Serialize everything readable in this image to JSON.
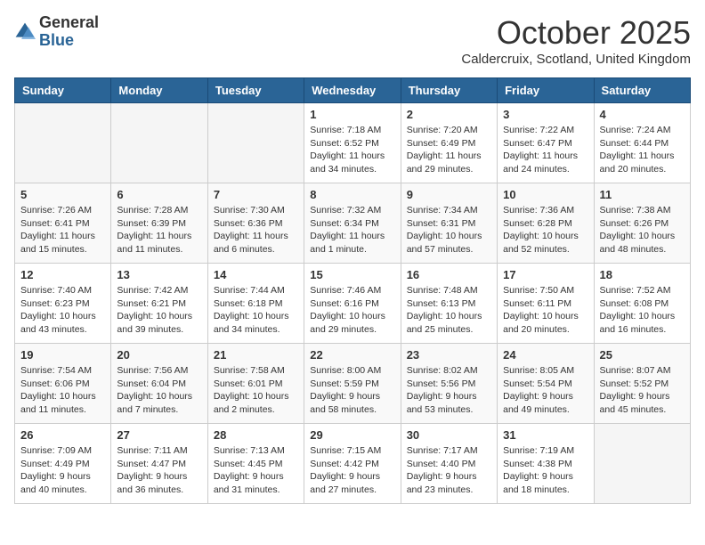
{
  "logo": {
    "general": "General",
    "blue": "Blue"
  },
  "title": "October 2025",
  "location": "Caldercruix, Scotland, United Kingdom",
  "days_of_week": [
    "Sunday",
    "Monday",
    "Tuesday",
    "Wednesday",
    "Thursday",
    "Friday",
    "Saturday"
  ],
  "weeks": [
    [
      {
        "day": "",
        "empty": true
      },
      {
        "day": "",
        "empty": true
      },
      {
        "day": "",
        "empty": true
      },
      {
        "day": "1",
        "sunrise": "7:18 AM",
        "sunset": "6:52 PM",
        "daylight": "11 hours and 34 minutes."
      },
      {
        "day": "2",
        "sunrise": "7:20 AM",
        "sunset": "6:49 PM",
        "daylight": "11 hours and 29 minutes."
      },
      {
        "day": "3",
        "sunrise": "7:22 AM",
        "sunset": "6:47 PM",
        "daylight": "11 hours and 24 minutes."
      },
      {
        "day": "4",
        "sunrise": "7:24 AM",
        "sunset": "6:44 PM",
        "daylight": "11 hours and 20 minutes."
      }
    ],
    [
      {
        "day": "5",
        "sunrise": "7:26 AM",
        "sunset": "6:41 PM",
        "daylight": "11 hours and 15 minutes."
      },
      {
        "day": "6",
        "sunrise": "7:28 AM",
        "sunset": "6:39 PM",
        "daylight": "11 hours and 11 minutes."
      },
      {
        "day": "7",
        "sunrise": "7:30 AM",
        "sunset": "6:36 PM",
        "daylight": "11 hours and 6 minutes."
      },
      {
        "day": "8",
        "sunrise": "7:32 AM",
        "sunset": "6:34 PM",
        "daylight": "11 hours and 1 minute."
      },
      {
        "day": "9",
        "sunrise": "7:34 AM",
        "sunset": "6:31 PM",
        "daylight": "10 hours and 57 minutes."
      },
      {
        "day": "10",
        "sunrise": "7:36 AM",
        "sunset": "6:28 PM",
        "daylight": "10 hours and 52 minutes."
      },
      {
        "day": "11",
        "sunrise": "7:38 AM",
        "sunset": "6:26 PM",
        "daylight": "10 hours and 48 minutes."
      }
    ],
    [
      {
        "day": "12",
        "sunrise": "7:40 AM",
        "sunset": "6:23 PM",
        "daylight": "10 hours and 43 minutes."
      },
      {
        "day": "13",
        "sunrise": "7:42 AM",
        "sunset": "6:21 PM",
        "daylight": "10 hours and 39 minutes."
      },
      {
        "day": "14",
        "sunrise": "7:44 AM",
        "sunset": "6:18 PM",
        "daylight": "10 hours and 34 minutes."
      },
      {
        "day": "15",
        "sunrise": "7:46 AM",
        "sunset": "6:16 PM",
        "daylight": "10 hours and 29 minutes."
      },
      {
        "day": "16",
        "sunrise": "7:48 AM",
        "sunset": "6:13 PM",
        "daylight": "10 hours and 25 minutes."
      },
      {
        "day": "17",
        "sunrise": "7:50 AM",
        "sunset": "6:11 PM",
        "daylight": "10 hours and 20 minutes."
      },
      {
        "day": "18",
        "sunrise": "7:52 AM",
        "sunset": "6:08 PM",
        "daylight": "10 hours and 16 minutes."
      }
    ],
    [
      {
        "day": "19",
        "sunrise": "7:54 AM",
        "sunset": "6:06 PM",
        "daylight": "10 hours and 11 minutes."
      },
      {
        "day": "20",
        "sunrise": "7:56 AM",
        "sunset": "6:04 PM",
        "daylight": "10 hours and 7 minutes."
      },
      {
        "day": "21",
        "sunrise": "7:58 AM",
        "sunset": "6:01 PM",
        "daylight": "10 hours and 2 minutes."
      },
      {
        "day": "22",
        "sunrise": "8:00 AM",
        "sunset": "5:59 PM",
        "daylight": "9 hours and 58 minutes."
      },
      {
        "day": "23",
        "sunrise": "8:02 AM",
        "sunset": "5:56 PM",
        "daylight": "9 hours and 53 minutes."
      },
      {
        "day": "24",
        "sunrise": "8:05 AM",
        "sunset": "5:54 PM",
        "daylight": "9 hours and 49 minutes."
      },
      {
        "day": "25",
        "sunrise": "8:07 AM",
        "sunset": "5:52 PM",
        "daylight": "9 hours and 45 minutes."
      }
    ],
    [
      {
        "day": "26",
        "sunrise": "7:09 AM",
        "sunset": "4:49 PM",
        "daylight": "9 hours and 40 minutes."
      },
      {
        "day": "27",
        "sunrise": "7:11 AM",
        "sunset": "4:47 PM",
        "daylight": "9 hours and 36 minutes."
      },
      {
        "day": "28",
        "sunrise": "7:13 AM",
        "sunset": "4:45 PM",
        "daylight": "9 hours and 31 minutes."
      },
      {
        "day": "29",
        "sunrise": "7:15 AM",
        "sunset": "4:42 PM",
        "daylight": "9 hours and 27 minutes."
      },
      {
        "day": "30",
        "sunrise": "7:17 AM",
        "sunset": "4:40 PM",
        "daylight": "9 hours and 23 minutes."
      },
      {
        "day": "31",
        "sunrise": "7:19 AM",
        "sunset": "4:38 PM",
        "daylight": "9 hours and 18 minutes."
      },
      {
        "day": "",
        "empty": true
      }
    ]
  ],
  "labels": {
    "sunrise": "Sunrise:",
    "sunset": "Sunset:",
    "daylight": "Daylight:"
  }
}
